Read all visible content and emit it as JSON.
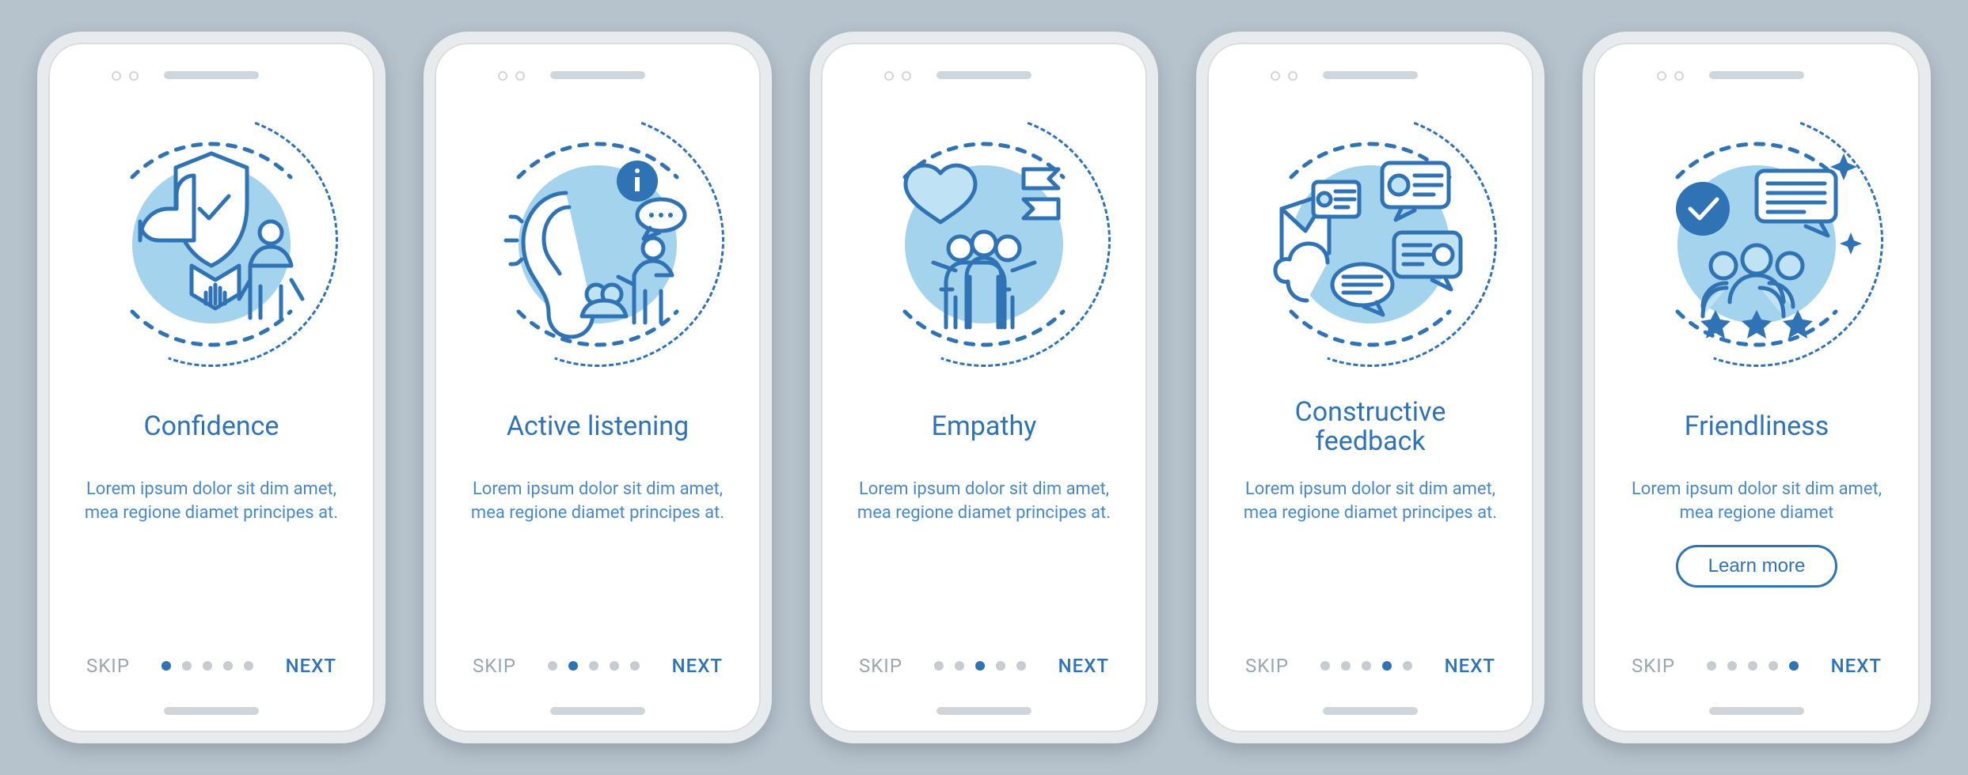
{
  "colors": {
    "primary": "#2f73b5",
    "accent": "#a4d3ee",
    "muted": "#c6ccd1"
  },
  "lorem": "Lorem ipsum dolor sit dim amet, mea regione diamet principes at.",
  "lorem_short": "Lorem ipsum dolor sit dim amet, mea regione diamet",
  "labels": {
    "skip": "SKIP",
    "next": "NEXT",
    "learn_more": "Learn more"
  },
  "screens": [
    {
      "title": "Confidence",
      "active_index": 0,
      "icon": "shield-thumb"
    },
    {
      "title": "Active listening",
      "active_index": 1,
      "icon": "ear-info"
    },
    {
      "title": "Empathy",
      "active_index": 2,
      "icon": "heart-people"
    },
    {
      "title": "Constructive feedback",
      "active_index": 3,
      "icon": "chat-bubbles"
    },
    {
      "title": "Friendliness",
      "active_index": 4,
      "icon": "check-stars",
      "learn_more": true,
      "short_desc": true
    }
  ],
  "dot_count": 5
}
